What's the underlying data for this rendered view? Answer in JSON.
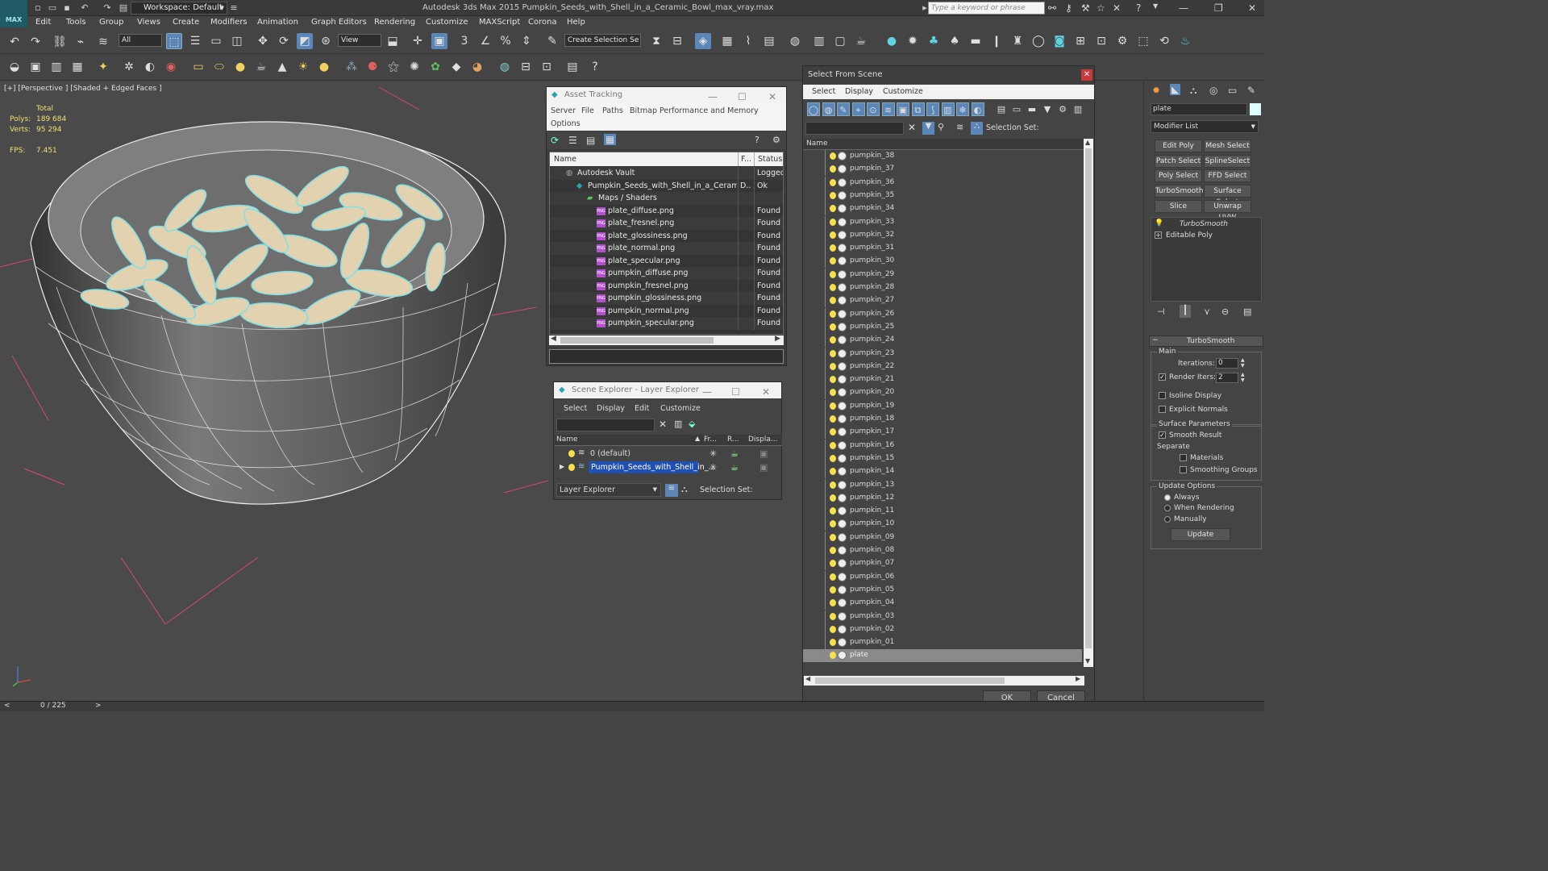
{
  "app": {
    "logo": "MAX",
    "workspace": "Workspace: Default",
    "title": "Autodesk 3ds Max  2015    Pumpkin_Seeds_with_Shell_in_a_Ceramic_Bowl_max_vray.max",
    "search_placeholder": "Type a keyword or phrase"
  },
  "menu": [
    "Edit",
    "Tools",
    "Group",
    "Views",
    "Create",
    "Modifiers",
    "Animation",
    "Graph Editors",
    "Rendering",
    "Customize",
    "MAXScript",
    "Corona",
    "Help"
  ],
  "toolbar": {
    "filter_value": "All",
    "refcoord_value": "View",
    "selection_set_value": "Create Selection Se"
  },
  "viewport": {
    "label": "[+] [Perspective ] [Shaded + Edged Faces ]",
    "stats_header": "Total",
    "polys_label": "Polys:",
    "polys_value": "189 684",
    "verts_label": "Verts:",
    "verts_value": "95 294",
    "fps_label": "FPS:",
    "fps_value": "7.451"
  },
  "timeline": {
    "frame": "0 / 225"
  },
  "asset_tracking": {
    "title": "Asset Tracking",
    "menu": [
      "Server",
      "File",
      "Paths",
      "Bitmap Performance and Memory"
    ],
    "menu2": "Options",
    "columns": [
      "Name",
      "F...",
      "Status"
    ],
    "rows": [
      {
        "name": "Autodesk Vault",
        "f": "",
        "status": "Logged"
      },
      {
        "name": "Pumpkin_Seeds_with_Shell_in_a_Ceramic...",
        "f": "D..",
        "status": "Ok"
      },
      {
        "name": "Maps / Shaders",
        "f": "",
        "status": ""
      },
      {
        "name": "plate_diffuse.png",
        "f": "",
        "status": "Found"
      },
      {
        "name": "plate_fresnel.png",
        "f": "",
        "status": "Found"
      },
      {
        "name": "plate_glossiness.png",
        "f": "",
        "status": "Found"
      },
      {
        "name": "plate_normal.png",
        "f": "",
        "status": "Found"
      },
      {
        "name": "plate_specular.png",
        "f": "",
        "status": "Found"
      },
      {
        "name": "pumpkin_diffuse.png",
        "f": "",
        "status": "Found"
      },
      {
        "name": "pumpkin_fresnel.png",
        "f": "",
        "status": "Found"
      },
      {
        "name": "pumpkin_glossiness.png",
        "f": "",
        "status": "Found"
      },
      {
        "name": "pumpkin_normal.png",
        "f": "",
        "status": "Found"
      },
      {
        "name": "pumpkin_specular.png",
        "f": "",
        "status": "Found"
      }
    ],
    "png_badge": "PNG"
  },
  "layer_explorer": {
    "title": "Scene Explorer - Layer Explorer",
    "menu": [
      "Select",
      "Display",
      "Edit",
      "Customize"
    ],
    "columns": [
      "Name",
      "Fr...",
      "R...",
      "Displa..."
    ],
    "rows": [
      {
        "name": "0 (default)"
      },
      {
        "name": "Pumpkin_Seeds_with_Shell_in_..."
      }
    ],
    "footer_dropdown": "Layer Explorer",
    "selection_set_label": "Selection Set:"
  },
  "select_from_scene": {
    "title": "Select From Scene",
    "menu": [
      "Select",
      "Display",
      "Customize"
    ],
    "selection_set_label": "Selection Set:",
    "column_name": "Name",
    "items": [
      "pumpkin_38",
      "pumpkin_37",
      "pumpkin_36",
      "pumpkin_35",
      "pumpkin_34",
      "pumpkin_33",
      "pumpkin_32",
      "pumpkin_31",
      "pumpkin_30",
      "pumpkin_29",
      "pumpkin_28",
      "pumpkin_27",
      "pumpkin_26",
      "pumpkin_25",
      "pumpkin_24",
      "pumpkin_23",
      "pumpkin_22",
      "pumpkin_21",
      "pumpkin_20",
      "pumpkin_19",
      "pumpkin_18",
      "pumpkin_17",
      "pumpkin_16",
      "pumpkin_15",
      "pumpkin_14",
      "pumpkin_13",
      "pumpkin_12",
      "pumpkin_11",
      "pumpkin_10",
      "pumpkin_09",
      "pumpkin_08",
      "pumpkin_07",
      "pumpkin_06",
      "pumpkin_05",
      "pumpkin_04",
      "pumpkin_03",
      "pumpkin_02",
      "pumpkin_01",
      "plate"
    ],
    "ok": "OK",
    "cancel": "Cancel"
  },
  "command_panel": {
    "object_name": "plate",
    "modifier_list": "Modifier List",
    "buttons": [
      "Edit Poly",
      "Mesh Select",
      "Patch Select",
      "SplineSelect",
      "Poly Select",
      "FFD Select",
      "TurboSmooth",
      "Surface Select",
      "Slice",
      "Unwrap UVW"
    ],
    "stack": [
      "TurboSmooth",
      "Editable Poly"
    ],
    "rollout_title": "TurboSmooth",
    "main_label": "Main",
    "iterations_label": "Iterations:",
    "iterations_value": "0",
    "render_iters_label": "Render Iters:",
    "render_iters_value": "2",
    "isoline_label": "Isoline Display",
    "explicit_normals_label": "Explicit Normals",
    "surface_params_label": "Surface Parameters",
    "smooth_result_label": "Smooth Result",
    "separate_label": "Separate",
    "materials_label": "Materials",
    "smoothing_groups_label": "Smoothing Groups",
    "update_options_label": "Update Options",
    "always_label": "Always",
    "when_rendering_label": "When Rendering",
    "manually_label": "Manually",
    "update_button": "Update"
  }
}
